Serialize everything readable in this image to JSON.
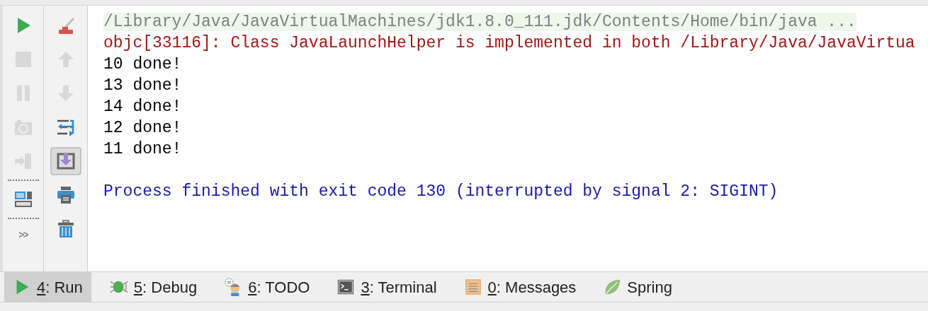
{
  "toolbar_left": [
    {
      "kind": "run",
      "disabled": false
    },
    {
      "kind": "stop",
      "disabled": true
    },
    {
      "kind": "pause",
      "disabled": true
    },
    {
      "kind": "camera",
      "disabled": true
    },
    {
      "kind": "exit",
      "disabled": true
    },
    {
      "kind": "separator"
    },
    {
      "kind": "layout",
      "disabled": false
    },
    {
      "kind": "separator"
    },
    {
      "kind": "more",
      "text": ">>"
    }
  ],
  "toolbar_right": [
    {
      "kind": "clear",
      "disabled": false
    },
    {
      "kind": "up",
      "disabled": true
    },
    {
      "kind": "down",
      "disabled": true
    },
    {
      "kind": "wrap",
      "disabled": false
    },
    {
      "kind": "scroll-end",
      "disabled": false,
      "on": true
    },
    {
      "kind": "print",
      "disabled": false
    },
    {
      "kind": "trash",
      "disabled": false
    }
  ],
  "console": [
    {
      "kind": "command",
      "text": "/Library/Java/JavaVirtualMachines/jdk1.8.0_111.jdk/Contents/Home/bin/java ..."
    },
    {
      "kind": "error",
      "text": "objc[33116]: Class JavaLaunchHelper is implemented in both /Library/Java/JavaVirtua"
    },
    {
      "kind": "output",
      "text": "10 done!"
    },
    {
      "kind": "output",
      "text": "13 done!"
    },
    {
      "kind": "output",
      "text": "14 done!"
    },
    {
      "kind": "output",
      "text": "12 done!"
    },
    {
      "kind": "output",
      "text": "11 done!"
    },
    {
      "kind": "blank"
    },
    {
      "kind": "system",
      "text": "Process finished with exit code 130 (interrupted by signal 2: SIGINT)"
    }
  ],
  "tool_tabs": [
    {
      "kind": "run",
      "label": "4: Run",
      "mnemonic": true,
      "selected": true
    },
    {
      "kind": "debug",
      "label": "5: Debug",
      "mnemonic": true,
      "selected": false
    },
    {
      "kind": "todo",
      "label": "6: TODO",
      "mnemonic": true,
      "selected": false
    },
    {
      "kind": "terminal",
      "label": "3: Terminal",
      "mnemonic": true,
      "selected": false
    },
    {
      "kind": "messages",
      "label": "0: Messages",
      "mnemonic": true,
      "selected": false
    },
    {
      "kind": "spring",
      "label": "Spring",
      "mnemonic": false,
      "selected": false
    }
  ]
}
